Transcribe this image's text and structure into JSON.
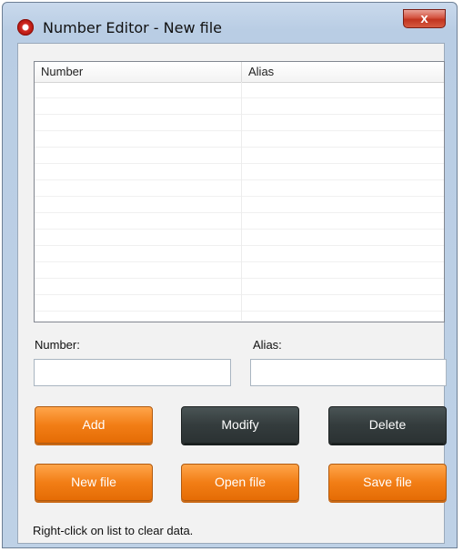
{
  "window": {
    "title": "Number Editor - New file",
    "close_glyph": "x"
  },
  "list": {
    "columns": [
      "Number",
      "Alias"
    ],
    "rows": []
  },
  "form": {
    "number_label": "Number:",
    "number_value": "",
    "alias_label": "Alias:",
    "alias_value": ""
  },
  "buttons": {
    "add": "Add",
    "modify": "Modify",
    "delete": "Delete",
    "new_file": "New file",
    "open_file": "Open file",
    "save_file": "Save file"
  },
  "hint": "Right-click on list to clear data.",
  "icons": {
    "app": "app-logo-icon",
    "close": "close-icon"
  },
  "colors": {
    "orange_button": "#f27e16",
    "dark_button": "#343c3d"
  }
}
